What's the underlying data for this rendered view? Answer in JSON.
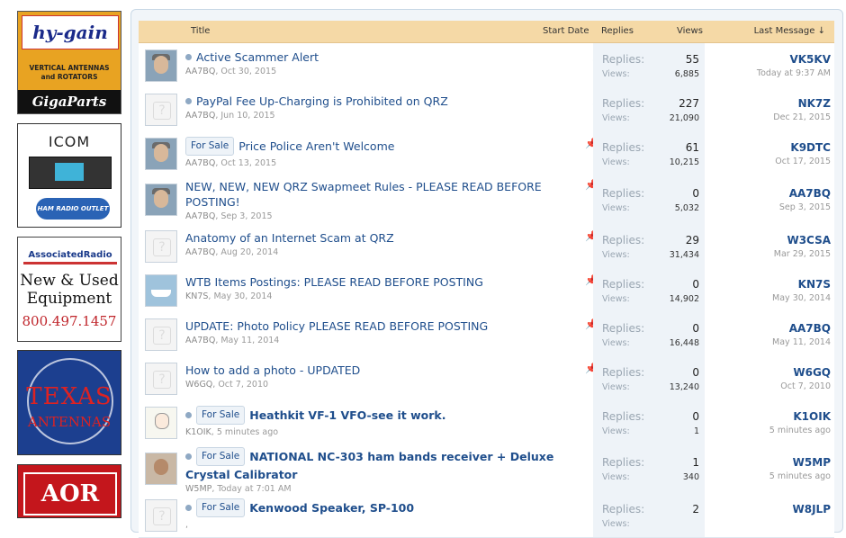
{
  "ads": {
    "hygain": {
      "brand": "hy-gain",
      "tagline_1": "VERTICAL ANTENNAS",
      "tagline_2": "and ROTATORS",
      "store": "GigaParts"
    },
    "icom": {
      "brand": "ICOM",
      "outlet": "HAM RADIO OUTLET"
    },
    "associated": {
      "brand": "AssociatedRadio",
      "line1": "New & Used",
      "line2": "Equipment",
      "phone": "800.497.1457"
    },
    "texas": {
      "line1": "TEXAS",
      "line2": "ANTENNAS"
    },
    "aor": {
      "brand": "AOR"
    }
  },
  "table": {
    "headers": {
      "title": "Title",
      "start_date": "Start Date",
      "replies": "Replies",
      "views": "Views",
      "last_message": "Last Message ↓"
    },
    "replies_label": "Replies:",
    "views_label": "Views:",
    "threads": [
      {
        "title": "Active Scammer Alert",
        "prefix": "",
        "author": "AA7BQ",
        "date": "Oct 30, 2015",
        "replies": "55",
        "views": "6,885",
        "last_user": "VK5KV",
        "last_time": "Today at 9:37 AM",
        "pinned": true,
        "locked": false,
        "unread": true,
        "avatar": "photo",
        "bold": false
      },
      {
        "title": "PayPal Fee Up-Charging is Prohibited on QRZ",
        "prefix": "",
        "author": "AA7BQ",
        "date": "Jun 10, 2015",
        "replies": "227",
        "views": "21,090",
        "last_user": "NK7Z",
        "last_time": "Dec 21, 2015",
        "pinned": true,
        "locked": false,
        "unread": true,
        "avatar": "placeholder",
        "bold": false
      },
      {
        "title": "Price Police Aren't Welcome",
        "prefix": "For Sale",
        "author": "AA7BQ",
        "date": "Oct 13, 2015",
        "replies": "61",
        "views": "10,215",
        "last_user": "K9DTC",
        "last_time": "Oct 17, 2015",
        "pinned": true,
        "locked": true,
        "unread": false,
        "avatar": "photo",
        "bold": false
      },
      {
        "title": "NEW, NEW, NEW QRZ Swapmeet Rules - PLEASE READ BEFORE POSTING!",
        "prefix": "",
        "author": "AA7BQ",
        "date": "Sep 3, 2015",
        "replies": "0",
        "views": "5,032",
        "last_user": "AA7BQ",
        "last_time": "Sep 3, 2015",
        "pinned": true,
        "locked": true,
        "unread": false,
        "avatar": "photo",
        "bold": false
      },
      {
        "title": "Anatomy of an Internet Scam at QRZ",
        "prefix": "",
        "author": "AA7BQ",
        "date": "Aug 20, 2014",
        "replies": "29",
        "views": "31,434",
        "last_user": "W3CSA",
        "last_time": "Mar 29, 2015",
        "pinned": true,
        "locked": true,
        "unread": false,
        "avatar": "placeholder",
        "bold": false
      },
      {
        "title": "WTB Items Postings: PLEASE READ BEFORE POSTING",
        "prefix": "",
        "author": "KN7S",
        "date": "May 30, 2014",
        "replies": "0",
        "views": "14,902",
        "last_user": "KN7S",
        "last_time": "May 30, 2014",
        "pinned": true,
        "locked": true,
        "unread": false,
        "avatar": "boat",
        "bold": false
      },
      {
        "title": "UPDATE: Photo Policy PLEASE READ BEFORE POSTING",
        "prefix": "",
        "author": "AA7BQ",
        "date": "May 11, 2014",
        "replies": "0",
        "views": "16,448",
        "last_user": "AA7BQ",
        "last_time": "May 11, 2014",
        "pinned": true,
        "locked": true,
        "unread": false,
        "avatar": "placeholder",
        "bold": false
      },
      {
        "title": "How to add a photo - UPDATED",
        "prefix": "",
        "author": "W6GQ",
        "date": "Oct 7, 2010",
        "replies": "0",
        "views": "13,240",
        "last_user": "W6GQ",
        "last_time": "Oct 7, 2010",
        "pinned": true,
        "locked": true,
        "unread": false,
        "avatar": "placeholder",
        "bold": false
      },
      {
        "title": "Heathkit VF-1 VFO-see it work.",
        "prefix": "For Sale",
        "author": "K1OIK",
        "date": "5 minutes ago",
        "replies": "0",
        "views": "1",
        "last_user": "K1OIK",
        "last_time": "5 minutes ago",
        "pinned": false,
        "locked": false,
        "unread": true,
        "avatar": "draw",
        "bold": true
      },
      {
        "title": "NATIONAL NC-303 ham bands receiver + Deluxe Crystal Calibrator",
        "prefix": "For Sale",
        "author": "W5MP",
        "date": "Today at 7:01 AM",
        "replies": "1",
        "views": "340",
        "last_user": "W5MP",
        "last_time": "5 minutes ago",
        "pinned": false,
        "locked": false,
        "unread": true,
        "avatar": "man",
        "bold": true
      },
      {
        "title": "Kenwood Speaker, SP-100",
        "prefix": "For Sale",
        "author": "",
        "date": "",
        "replies": "2",
        "views": "",
        "last_user": "W8JLP",
        "last_time": "",
        "pinned": false,
        "locked": false,
        "unread": true,
        "avatar": "placeholder",
        "bold": true
      }
    ]
  }
}
